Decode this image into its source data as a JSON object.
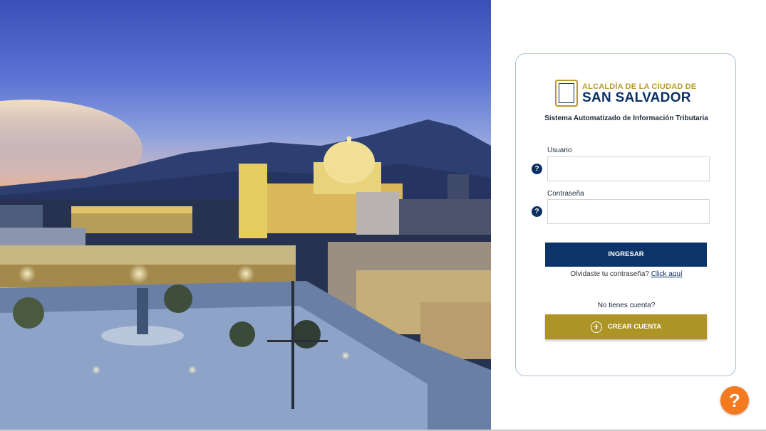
{
  "logo": {
    "line1": "ALCALDÍA DE LA CIUDAD DE",
    "line2": "SAN SALVADOR",
    "icon": "city-shield-icon"
  },
  "system_title": "Sistema Automatizado de Información Tributaria",
  "form": {
    "username_label": "Usuario",
    "username_value": "",
    "password_label": "Contraseña",
    "password_value": "",
    "help_icon_glyph": "?",
    "login_button": "INGRESAR",
    "forgot_text": "Olvidaste tu contraseña?",
    "forgot_link": "Click aquí",
    "no_account_text": "No tienes cuenta?",
    "create_account_button": "CREAR CUENTA"
  },
  "help_fab_glyph": "?",
  "colors": {
    "primary": "#0d3468",
    "gold": "#ac9426",
    "help_fab": "#f47a20"
  }
}
